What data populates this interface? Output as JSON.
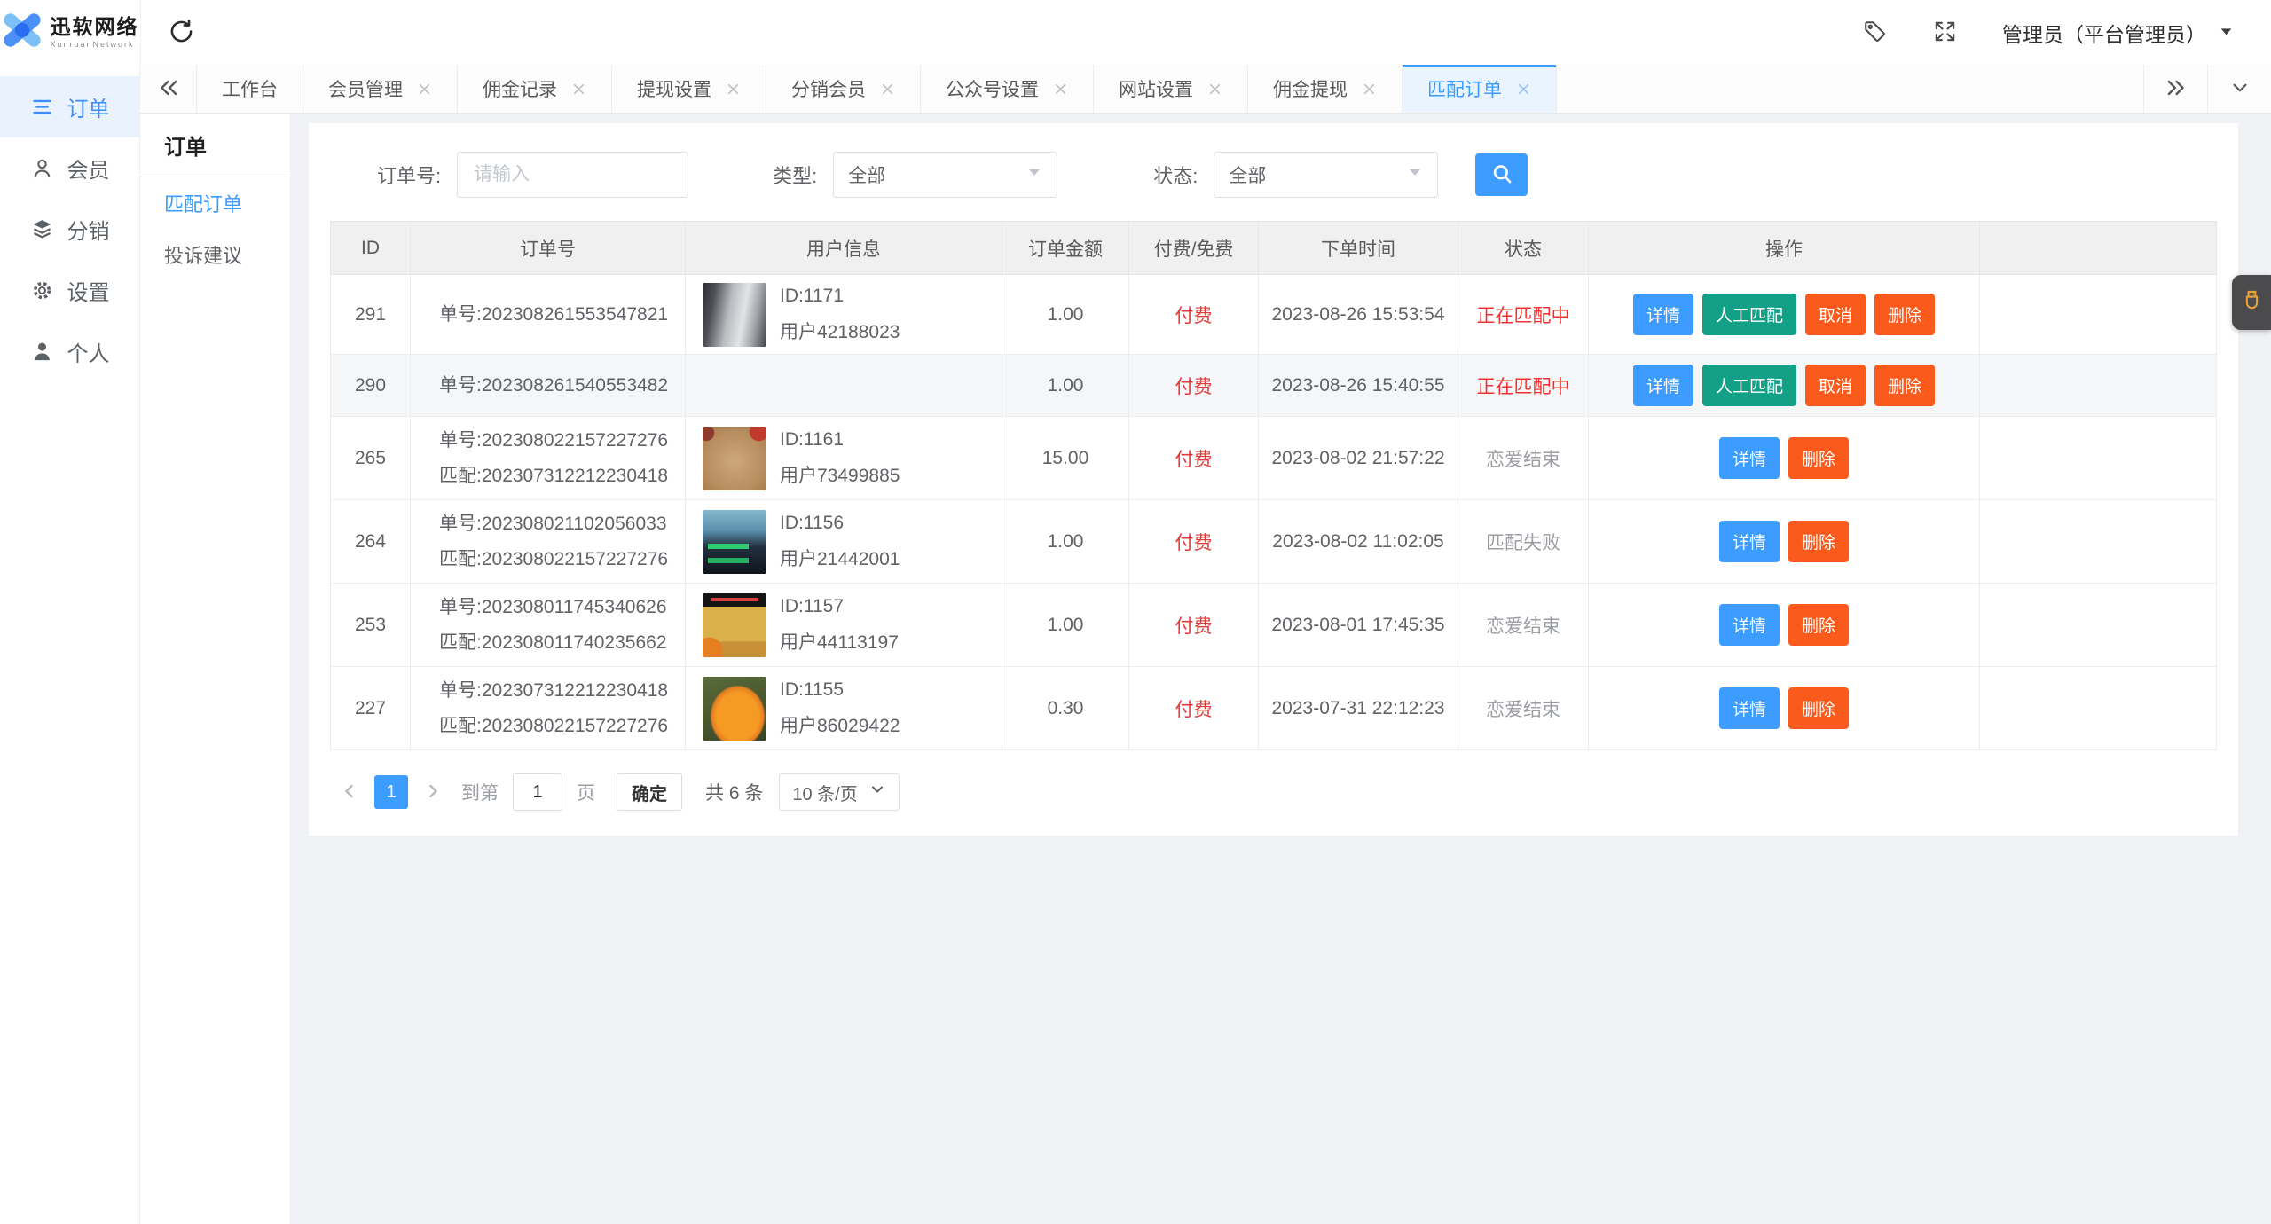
{
  "topbar": {
    "logo_text": "迅软网络",
    "logo_subtext": "XunruanNetwork",
    "admin_label": "管理员（平台管理员）"
  },
  "tabbar": {
    "tabs": [
      {
        "label": "工作台",
        "closable": false,
        "active": false
      },
      {
        "label": "会员管理",
        "closable": true,
        "active": false
      },
      {
        "label": "佣金记录",
        "closable": true,
        "active": false
      },
      {
        "label": "提现设置",
        "closable": true,
        "active": false
      },
      {
        "label": "分销会员",
        "closable": true,
        "active": false
      },
      {
        "label": "公众号设置",
        "closable": true,
        "active": false
      },
      {
        "label": "网站设置",
        "closable": true,
        "active": false
      },
      {
        "label": "佣金提现",
        "closable": true,
        "active": false
      },
      {
        "label": "匹配订单",
        "closable": true,
        "active": true
      }
    ]
  },
  "sidebar": {
    "items": [
      {
        "label": "订单",
        "icon": "order-list-icon",
        "active": true
      },
      {
        "label": "会员",
        "icon": "member-icon",
        "active": false
      },
      {
        "label": "分销",
        "icon": "distribution-layers-icon",
        "active": false
      },
      {
        "label": "设置",
        "icon": "settings-gear-icon",
        "active": false
      },
      {
        "label": "个人",
        "icon": "profile-person-icon",
        "active": false
      }
    ]
  },
  "submenu": {
    "title": "订单",
    "items": [
      {
        "label": "匹配订单",
        "active": true
      },
      {
        "label": "投诉建议",
        "active": false
      }
    ]
  },
  "filters": {
    "order_no_label": "订单号:",
    "order_no_placeholder": "请输入",
    "type_label": "类型:",
    "type_value": "全部",
    "status_label": "状态:",
    "status_value": "全部"
  },
  "table": {
    "columns": [
      "ID",
      "订单号",
      "用户信息",
      "订单金额",
      "付费/免费",
      "下单时间",
      "状态",
      "操作",
      ""
    ],
    "rows": [
      {
        "id": "291",
        "order_no": "单号:202308261553547821",
        "match_no": "",
        "user_id": "ID:1171",
        "user_name": "用户42188023",
        "avatar": "anime-portrait",
        "amount": "1.00",
        "pay": "付费",
        "time": "2023-08-26 15:53:54",
        "status": "正在匹配中",
        "status_red": true,
        "striped": false,
        "buttons": [
          {
            "label": "详情",
            "type": "info"
          },
          {
            "label": "人工匹配",
            "type": "success"
          },
          {
            "label": "取消",
            "type": "danger"
          },
          {
            "label": "删除",
            "type": "danger"
          }
        ]
      },
      {
        "id": "290",
        "order_no": "单号:202308261540553482",
        "match_no": "",
        "user_id": "",
        "user_name": "",
        "avatar": "",
        "amount": "1.00",
        "pay": "付费",
        "time": "2023-08-26 15:40:55",
        "status": "正在匹配中",
        "status_red": true,
        "striped": true,
        "buttons": [
          {
            "label": "详情",
            "type": "info"
          },
          {
            "label": "人工匹配",
            "type": "success"
          },
          {
            "label": "取消",
            "type": "danger"
          },
          {
            "label": "删除",
            "type": "danger"
          }
        ]
      },
      {
        "id": "265",
        "order_no": "单号:202308022157227276",
        "match_no": "匹配:202307312212230418",
        "user_id": "ID:1161",
        "user_name": "用户73499885",
        "avatar": "dog-photo",
        "amount": "15.00",
        "pay": "付费",
        "time": "2023-08-02 21:57:22",
        "status": "恋爱结束",
        "status_red": false,
        "striped": false,
        "buttons": [
          {
            "label": "详情",
            "type": "info"
          },
          {
            "label": "删除",
            "type": "danger"
          }
        ]
      },
      {
        "id": "264",
        "order_no": "单号:202308021102056033",
        "match_no": "匹配:202308022157227276",
        "user_id": "ID:1156",
        "user_name": "用户21442001",
        "avatar": "karaoke-screenshot",
        "amount": "1.00",
        "pay": "付费",
        "time": "2023-08-02 11:02:05",
        "status": "匹配失败",
        "status_red": false,
        "striped": false,
        "buttons": [
          {
            "label": "详情",
            "type": "info"
          },
          {
            "label": "删除",
            "type": "danger"
          }
        ]
      },
      {
        "id": "253",
        "order_no": "单号:202308011745340626",
        "match_no": "匹配:202308011740235662",
        "user_id": "ID:1157",
        "user_name": "用户44113197",
        "avatar": "monkey-photo",
        "amount": "1.00",
        "pay": "付费",
        "time": "2023-08-01 17:45:35",
        "status": "恋爱结束",
        "status_red": false,
        "striped": false,
        "buttons": [
          {
            "label": "详情",
            "type": "info"
          },
          {
            "label": "删除",
            "type": "danger"
          }
        ]
      },
      {
        "id": "227",
        "order_no": "单号:202307312212230418",
        "match_no": "匹配:202308022157227276",
        "user_id": "ID:1155",
        "user_name": "用户86029422",
        "avatar": "garfield-cartoon",
        "amount": "0.30",
        "pay": "付费",
        "time": "2023-07-31 22:12:23",
        "status": "恋爱结束",
        "status_red": false,
        "striped": false,
        "buttons": [
          {
            "label": "详情",
            "type": "info"
          },
          {
            "label": "删除",
            "type": "danger"
          }
        ]
      }
    ]
  },
  "pagination": {
    "current_page": "1",
    "goto_label": "到第",
    "page_input": "1",
    "page_suffix": "页",
    "confirm_label": "确定",
    "total_label": "共 6 条",
    "page_size": "10 条/页"
  },
  "colors": {
    "primary_blue": "#3c9cff",
    "success_green": "#12a186",
    "danger_orange": "#fa5a1c",
    "status_red": "#f23030",
    "pay_red": "#e23b3b",
    "active_tab_bg": "#e9f4fe",
    "widget_icon_orange": "#e8a33d"
  }
}
